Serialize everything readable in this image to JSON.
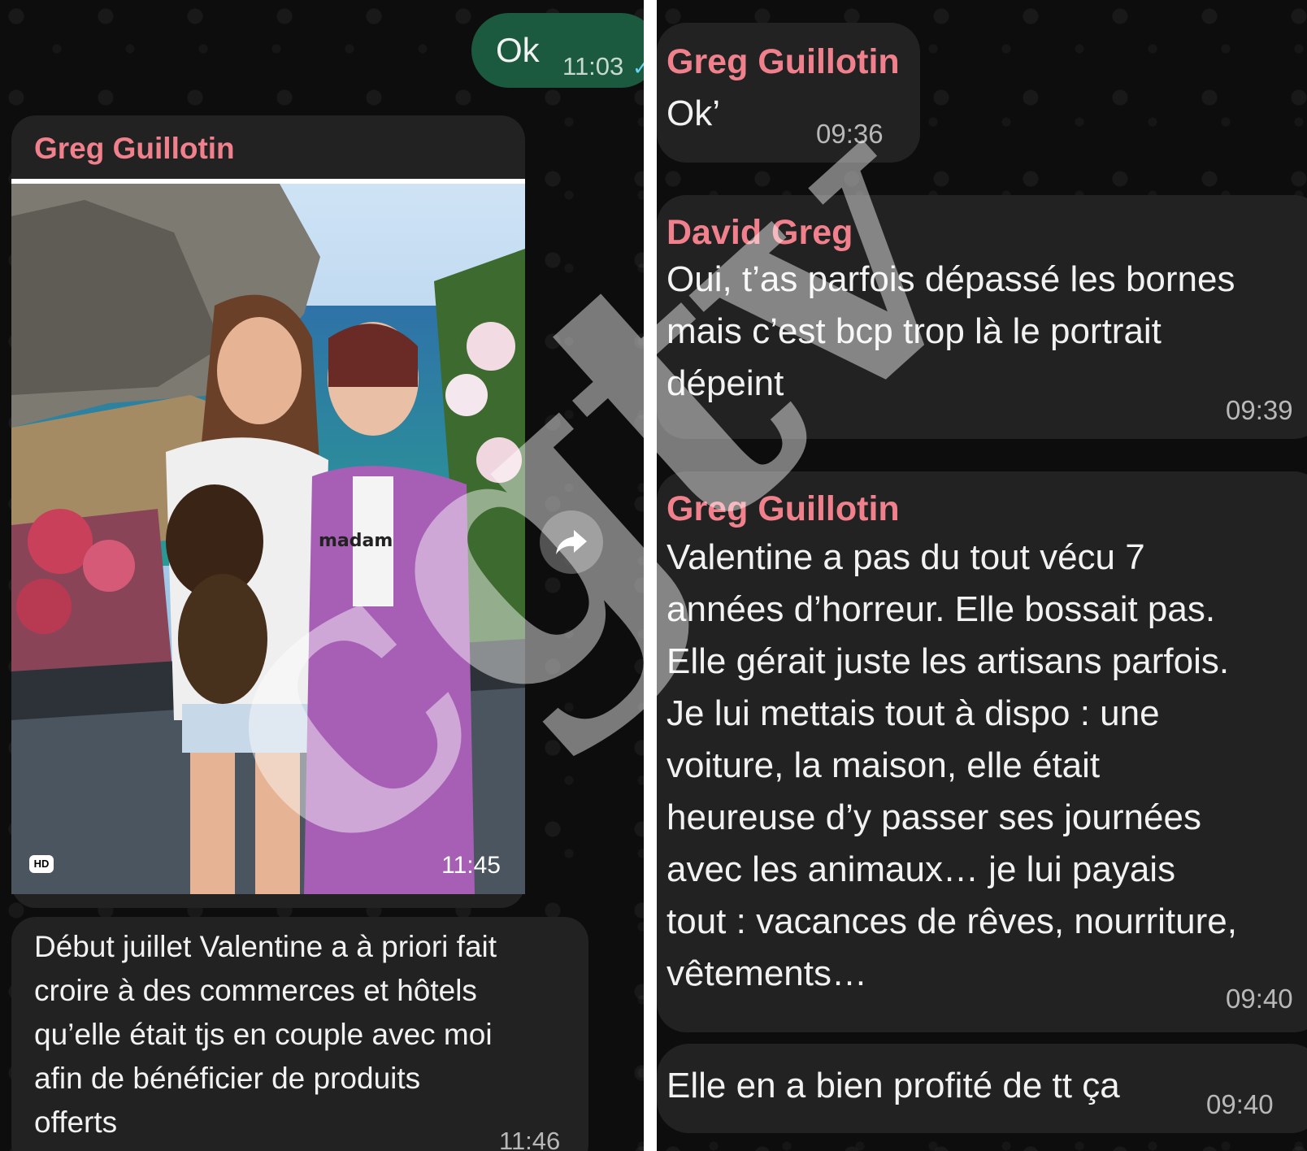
{
  "left": {
    "outgoing": {
      "text": "Ok",
      "time": "11:03"
    },
    "photo_message": {
      "sender": "Greg Guillotin",
      "time": "11:45",
      "hd_badge": "HD",
      "shirt_text": "madam"
    },
    "caption_message": {
      "lines": [
        "Début juillet Valentine a à priori fait",
        "croire à des commerces et hôtels",
        "qu’elle était tjs en couple avec moi",
        "afin de bénéficier de produits",
        "offerts"
      ],
      "time": "11:46"
    }
  },
  "right": {
    "msg1": {
      "sender": "Greg Guillotin",
      "text": "Ok’",
      "time": "09:36"
    },
    "msg2": {
      "sender": "David Greg",
      "lines": [
        "Oui, t’as parfois dépassé les bornes",
        "mais c’est bcp trop là le portrait",
        "dépeint"
      ],
      "time": "09:39"
    },
    "msg3": {
      "sender": "Greg Guillotin",
      "lines": [
        "Valentine a pas du tout vécu 7",
        "années d’horreur. Elle bossait pas.",
        "Elle gérait juste les artisans parfois.",
        "Je lui mettais tout à dispo : une",
        "voiture, la maison, elle était",
        "heureuse d’y passer ses journées",
        "avec les animaux… je lui payais",
        "tout : vacances de rêves, nourriture,",
        "vêtements…"
      ],
      "time": "09:40"
    },
    "msg4": {
      "text": "Elle en a bien profité de tt ça",
      "time": "09:40"
    }
  },
  "watermark": "cgtv",
  "colors": {
    "background": "#0d0d0d",
    "bubble": "#222222",
    "outgoing_bubble": "#1b5a3f",
    "sender_name": "#f0808b",
    "timestamp": "#b8b8b8",
    "read_check": "#6ad2f2"
  },
  "icons": [
    "double-check-icon",
    "hd-icon",
    "forward-icon"
  ]
}
